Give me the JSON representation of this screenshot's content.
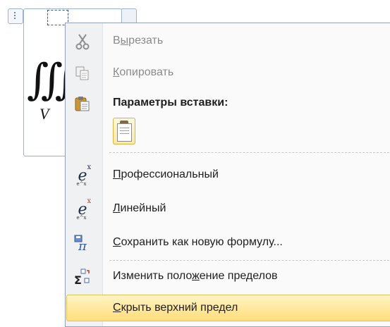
{
  "equation": {
    "integral_symbol": "∭",
    "subscript": "V"
  },
  "menu": {
    "items": [
      {
        "id": "cut",
        "pre": "В",
        "accel": "ы",
        "post": "резать",
        "icon": "scissors-icon",
        "enabled": false
      },
      {
        "id": "copy",
        "pre": "",
        "accel": "К",
        "post": "опировать",
        "icon": "copy-icon",
        "enabled": false
      },
      {
        "id": "paste_options",
        "label": "Параметры вставки:",
        "icon": "paste-icon"
      },
      {
        "id": "professional",
        "pre": "",
        "accel": "П",
        "post": "рофессиональный",
        "icon": "professional-format-icon"
      },
      {
        "id": "linear",
        "pre": "",
        "accel": "Л",
        "post": "инейный",
        "icon": "linear-format-icon"
      },
      {
        "id": "save_formula",
        "pre": "",
        "accel": "С",
        "post": "охранить как новую формулу...",
        "icon": "save-as-new-equation-icon"
      },
      {
        "id": "change_limits",
        "pre": "Изменить поло",
        "accel": "ж",
        "post": "ение пределов",
        "icon": "limit-location-icon"
      },
      {
        "id": "hide_upper",
        "pre": "",
        "accel": "С",
        "post": "крыть верхний предел",
        "icon": "",
        "highlighted": true
      }
    ]
  },
  "colors": {
    "highlight": "#ffe79a",
    "menu_border": "#97a5b8",
    "disabled_text": "#8b8b8b"
  }
}
